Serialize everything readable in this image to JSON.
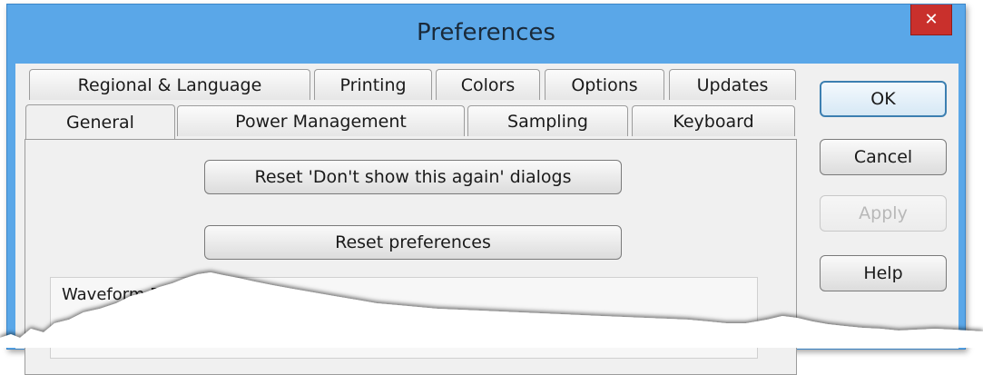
{
  "window": {
    "title": "Preferences",
    "close_glyph": "✕"
  },
  "tabs_back": [
    {
      "label": "Regional & Language"
    },
    {
      "label": "Printing"
    },
    {
      "label": "Colors"
    },
    {
      "label": "Options"
    },
    {
      "label": "Updates"
    }
  ],
  "tabs_front": [
    {
      "label": "General",
      "active": true
    },
    {
      "label": "Power Management"
    },
    {
      "label": "Sampling"
    },
    {
      "label": "Keyboard"
    }
  ],
  "panel": {
    "reset_dialogs_label": "Reset 'Don't show this again' dialogs",
    "reset_prefs_label": "Reset preferences",
    "group_label": "Waveform B"
  },
  "dialog_buttons": {
    "ok": "OK",
    "cancel": "Cancel",
    "apply": "Apply",
    "help": "Help"
  },
  "colors": {
    "titlebar": "#5aa7e8",
    "close": "#c9302c",
    "client": "#f0f0f0",
    "default_button_border": "#3c7fb1"
  },
  "icons": {
    "close": "close-icon"
  }
}
